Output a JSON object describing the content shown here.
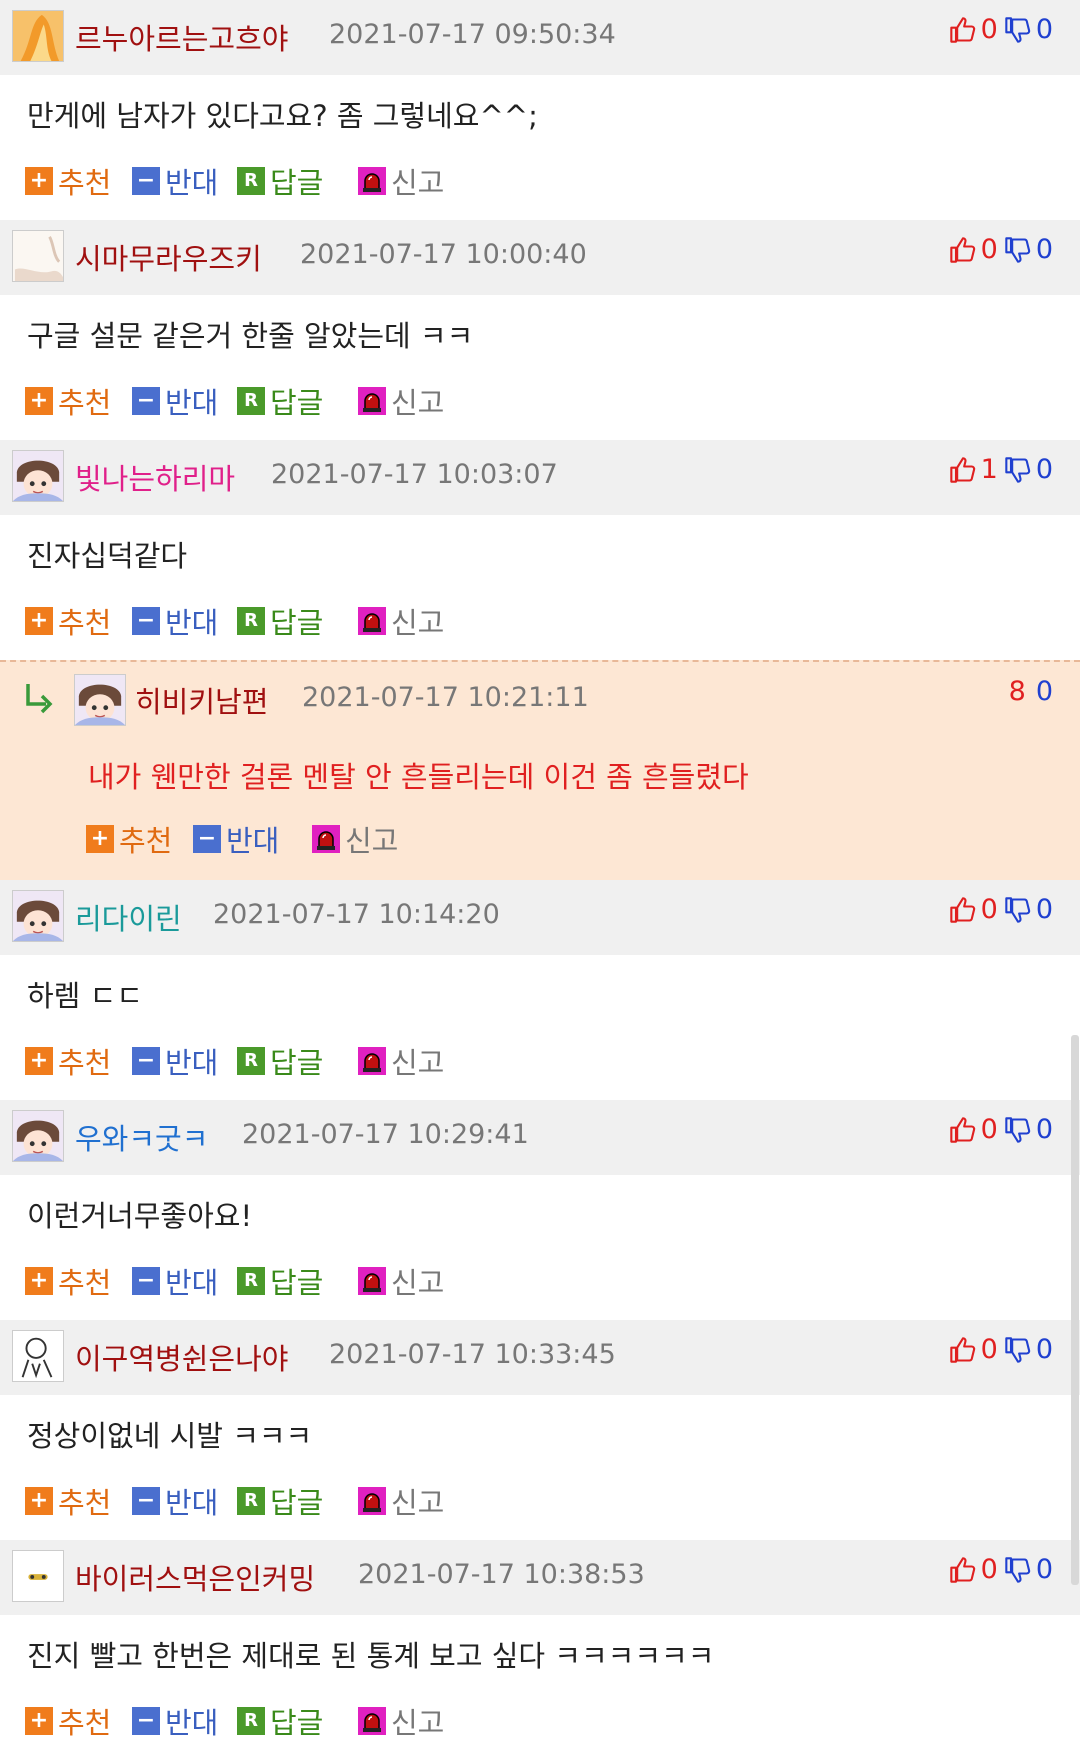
{
  "actions": {
    "recommend": "추천",
    "oppose": "반대",
    "reply": "답글",
    "report": "신고"
  },
  "comments": [
    {
      "nick": "르누아르는고흐야",
      "nick_color": "#a01010",
      "time": "2021-07-17 09:50:34",
      "up": "0",
      "down": "0",
      "text": "만게에 남자가 있다고요? 좀 그렇네요^^;",
      "avatar": "orange-avatar"
    },
    {
      "nick": "시마무라우즈키",
      "nick_color": "#a01010",
      "time": "2021-07-17 10:00:40",
      "up": "0",
      "down": "0",
      "text": "구글 설문 같은거 한줄 알았는데 ㅋㅋ",
      "avatar": "paper-avatar"
    },
    {
      "nick": "빛나는하리마",
      "nick_color": "#e0208a",
      "time": "2021-07-17 10:03:07",
      "up": "1",
      "down": "0",
      "text": "진자십덕같다",
      "avatar": "anime-avatar"
    },
    {
      "reply": true,
      "nick": "히비키남편",
      "nick_color": "#a01010",
      "time": "2021-07-17 10:21:11",
      "up": "8",
      "down": "0",
      "text": "내가 웬만한 걸론 멘탈 안 흔들리는데 이건 좀 흔들렸다",
      "avatar": "anime-avatar"
    },
    {
      "nick": "리다이린",
      "nick_color": "#1a9a9a",
      "time": "2021-07-17 10:14:20",
      "up": "0",
      "down": "0",
      "text": "하렘 ㄷㄷ",
      "avatar": "anime-avatar"
    },
    {
      "nick": "우와ㅋ굿ㅋ",
      "nick_color": "#2070d0",
      "time": "2021-07-17 10:29:41",
      "up": "0",
      "down": "0",
      "text": "이런거너무좋아요!",
      "avatar": "anime-avatar"
    },
    {
      "nick": "이구역병쉰은나야",
      "nick_color": "#a01010",
      "time": "2021-07-17 10:33:45",
      "up": "0",
      "down": "0",
      "text": "정상이없네 시발 ㅋㅋㅋ",
      "avatar": "sketch-avatar"
    },
    {
      "nick": "바이러스먹은인커밍",
      "nick_color": "#a01010",
      "time": "2021-07-17 10:38:53",
      "up": "0",
      "down": "0",
      "text": "진지 빨고 한번은 제대로 된 통계 보고 싶다 ㅋㅋㅋㅋㅋㅋ",
      "avatar": "small-avatar"
    }
  ]
}
